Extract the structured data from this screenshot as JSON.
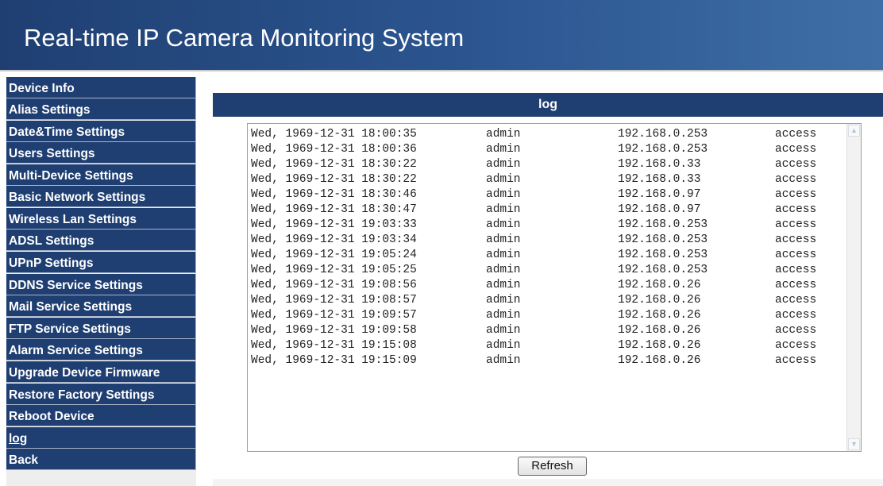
{
  "header": {
    "title": "Real-time IP Camera Monitoring System"
  },
  "sidebar": {
    "items": [
      {
        "label": "Device Info"
      },
      {
        "label": "Alias Settings"
      },
      {
        "label": "Date&Time Settings"
      },
      {
        "label": "Users Settings"
      },
      {
        "label": "Multi-Device Settings"
      },
      {
        "label": "Basic Network Settings"
      },
      {
        "label": "Wireless Lan Settings"
      },
      {
        "label": "ADSL Settings"
      },
      {
        "label": "UPnP Settings"
      },
      {
        "label": "DDNS Service Settings"
      },
      {
        "label": "Mail Service Settings"
      },
      {
        "label": "FTP Service Settings"
      },
      {
        "label": "Alarm Service Settings"
      },
      {
        "label": "Upgrade Device Firmware"
      },
      {
        "label": "Restore Factory Settings"
      },
      {
        "label": "Reboot Device"
      },
      {
        "label": "log"
      },
      {
        "label": "Back"
      }
    ]
  },
  "panel": {
    "title": "log"
  },
  "log": {
    "rows": [
      {
        "time": "Wed, 1969-12-31 18:00:35",
        "user": "admin",
        "ip": "192.168.0.253",
        "action": "access"
      },
      {
        "time": "Wed, 1969-12-31 18:00:36",
        "user": "admin",
        "ip": "192.168.0.253",
        "action": "access"
      },
      {
        "time": "Wed, 1969-12-31 18:30:22",
        "user": "admin",
        "ip": "192.168.0.33",
        "action": "access"
      },
      {
        "time": "Wed, 1969-12-31 18:30:22",
        "user": "admin",
        "ip": "192.168.0.33",
        "action": "access"
      },
      {
        "time": "Wed, 1969-12-31 18:30:46",
        "user": "admin",
        "ip": "192.168.0.97",
        "action": "access"
      },
      {
        "time": "Wed, 1969-12-31 18:30:47",
        "user": "admin",
        "ip": "192.168.0.97",
        "action": "access"
      },
      {
        "time": "Wed, 1969-12-31 19:03:33",
        "user": "admin",
        "ip": "192.168.0.253",
        "action": "access"
      },
      {
        "time": "Wed, 1969-12-31 19:03:34",
        "user": "admin",
        "ip": "192.168.0.253",
        "action": "access"
      },
      {
        "time": "Wed, 1969-12-31 19:05:24",
        "user": "admin",
        "ip": "192.168.0.253",
        "action": "access"
      },
      {
        "time": "Wed, 1969-12-31 19:05:25",
        "user": "admin",
        "ip": "192.168.0.253",
        "action": "access"
      },
      {
        "time": "Wed, 1969-12-31 19:08:56",
        "user": "admin",
        "ip": "192.168.0.26",
        "action": "access"
      },
      {
        "time": "Wed, 1969-12-31 19:08:57",
        "user": "admin",
        "ip": "192.168.0.26",
        "action": "access"
      },
      {
        "time": "Wed, 1969-12-31 19:09:57",
        "user": "admin",
        "ip": "192.168.0.26",
        "action": "access"
      },
      {
        "time": "Wed, 1969-12-31 19:09:58",
        "user": "admin",
        "ip": "192.168.0.26",
        "action": "access"
      },
      {
        "time": "Wed, 1969-12-31 19:15:08",
        "user": "admin",
        "ip": "192.168.0.26",
        "action": "access"
      },
      {
        "time": "Wed, 1969-12-31 19:15:09",
        "user": "admin",
        "ip": "192.168.0.26",
        "action": "access"
      }
    ]
  },
  "buttons": {
    "refresh": "Refresh"
  },
  "icons": {
    "scroll_up": "scroll-up-arrow-icon",
    "scroll_down": "scroll-down-arrow-icon"
  },
  "colors": {
    "nav_bg": "#1f3f72",
    "header_start": "#1f3f72",
    "header_end": "#3f6ea6"
  }
}
